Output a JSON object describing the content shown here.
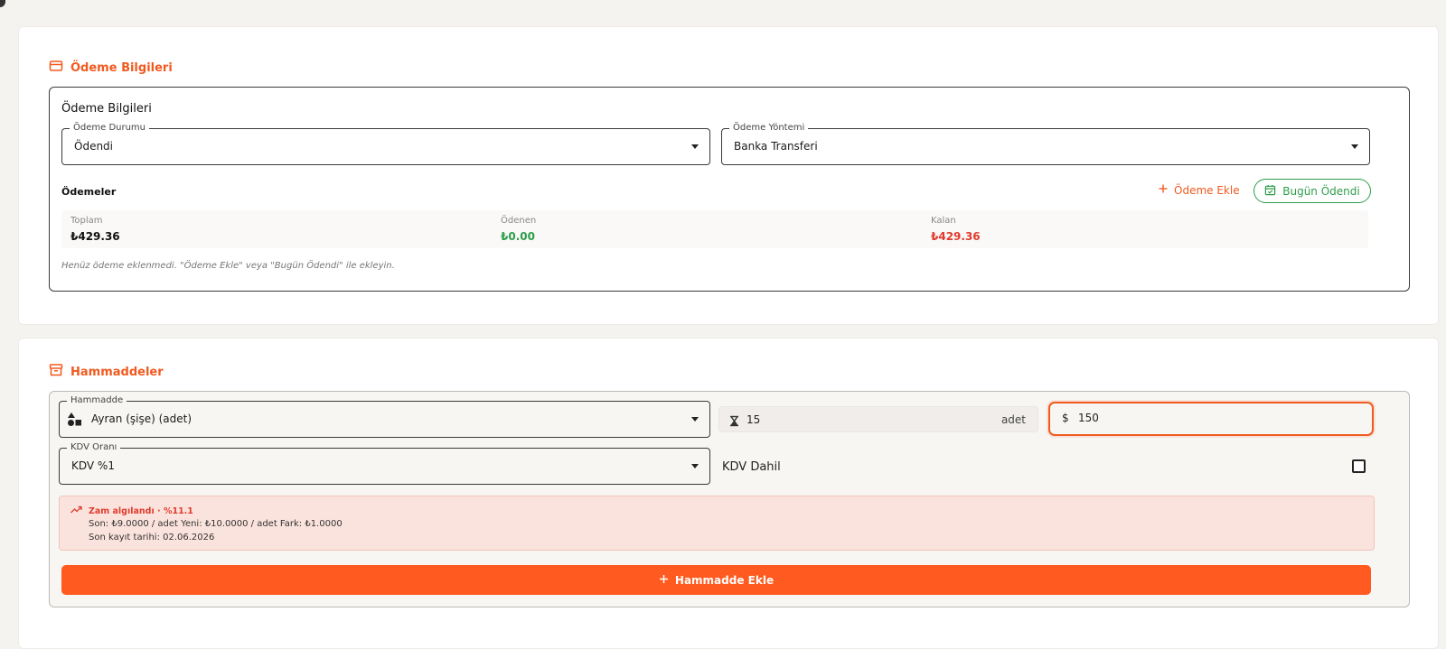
{
  "payment_section": {
    "title": "Ödeme Bilgileri",
    "inner_title": "Ödeme Bilgileri",
    "status_field": {
      "label": "Ödeme Durumu",
      "value": "Ödendi"
    },
    "method_field": {
      "label": "Ödeme Yöntemi",
      "value": "Banka Transferi"
    },
    "payments_label": "Ödemeler",
    "add_payment_label": "Ödeme Ekle",
    "paid_today_label": "Bugün Ödendi",
    "summary": {
      "total_label": "Toplam",
      "total_value": "₺429.36",
      "paid_label": "Ödenen",
      "paid_value": "₺0.00",
      "remaining_label": "Kalan",
      "remaining_value": "₺429.36"
    },
    "empty_note": "Henüz ödeme eklenmedi. \"Ödeme Ekle\" veya \"Bugün Ödendi\" ile ekleyin."
  },
  "raw_section": {
    "title": "Hammaddeler",
    "material_field": {
      "label": "Hammadde",
      "value": "Ayran (şişe) (adet)"
    },
    "quantity": {
      "value": "15",
      "unit": "adet"
    },
    "price": {
      "symbol": "$",
      "value": "150"
    },
    "vat_field": {
      "label": "KDV Oranı",
      "value": "KDV %1"
    },
    "vat_included_label": "KDV Dahil",
    "vat_included_checked": false,
    "alert": {
      "title": "Zam algılandı · %11.1",
      "line1": "Son: ₺9.0000 / adet  Yeni: ₺10.0000 / adet  Fark: ₺1.0000",
      "line2": "Son kayıt tarihi: 02.06.2026"
    },
    "add_button_label": "Hammadde Ekle"
  },
  "colors": {
    "accent": "#f05a1f",
    "success": "#2e9d4a",
    "danger": "#e03b2e"
  }
}
